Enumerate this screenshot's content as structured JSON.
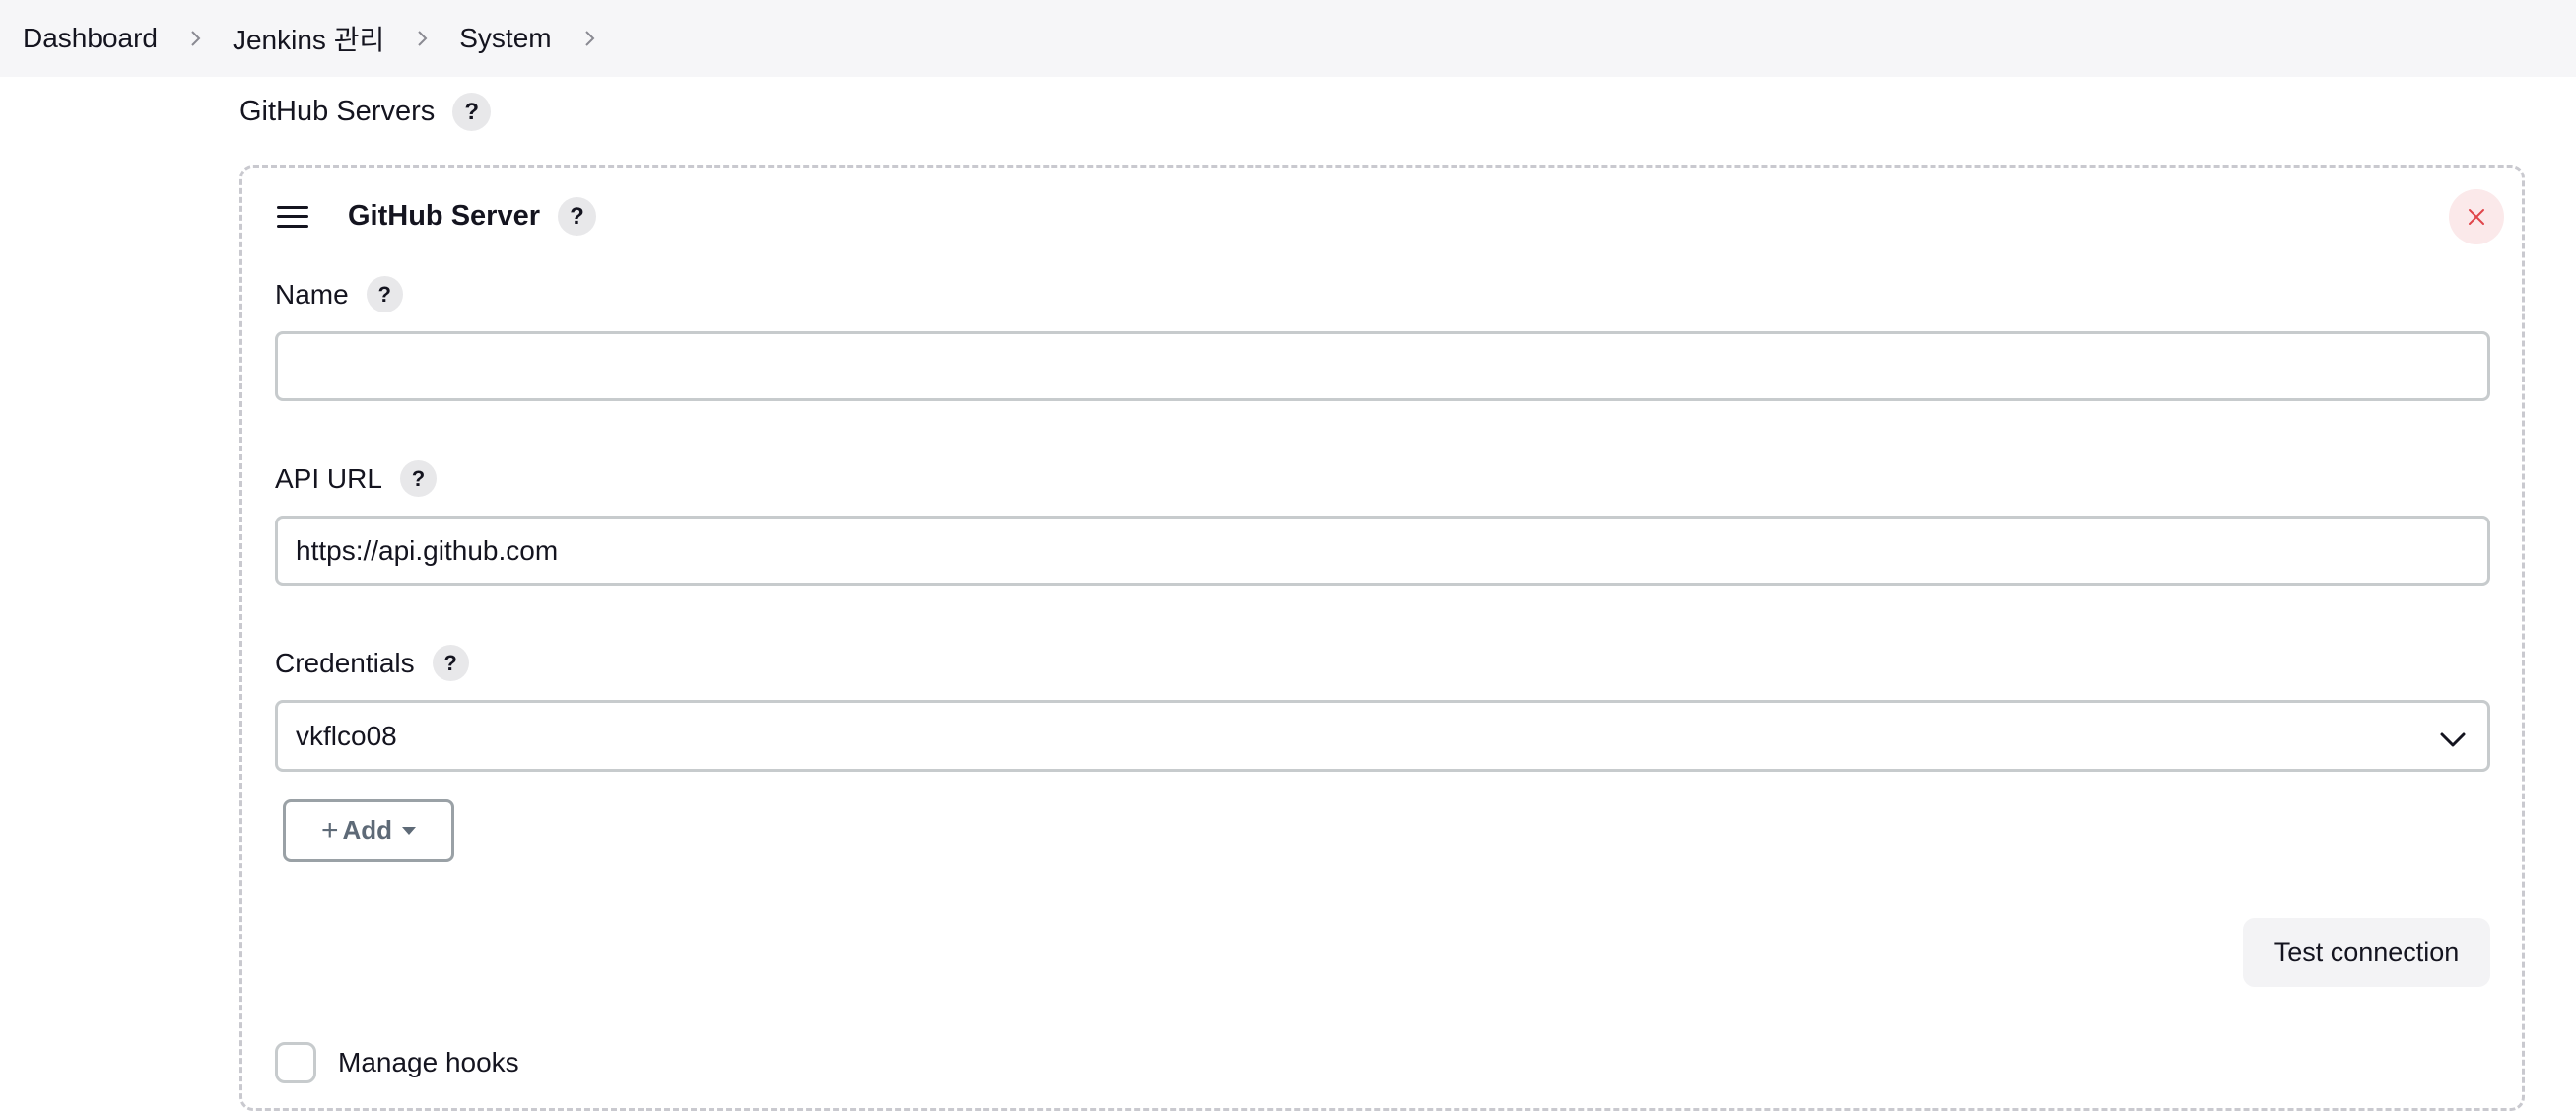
{
  "breadcrumb": {
    "items": [
      "Dashboard",
      "Jenkins 관리",
      "System"
    ]
  },
  "section": {
    "title": "GitHub Servers",
    "help": "?"
  },
  "server_card": {
    "title": "GitHub Server",
    "help": "?",
    "name_field": {
      "label": "Name",
      "help": "?",
      "value": ""
    },
    "api_url_field": {
      "label": "API URL",
      "help": "?",
      "value": "https://api.github.com"
    },
    "credentials_field": {
      "label": "Credentials",
      "help": "?",
      "selected": "vkflco08"
    },
    "add_button": {
      "plus": "+",
      "label": "Add"
    },
    "test_connection_label": "Test connection",
    "manage_hooks_label": "Manage hooks"
  },
  "icons": {
    "crumb_separator": "chevron-right-icon",
    "drag": "drag-handle-icon",
    "close": "close-icon",
    "select_chevron": "chevron-down-icon",
    "add_caret": "caret-down-icon"
  },
  "colors": {
    "close_icon": "#e0464b",
    "close_bg": "#fbe9ea",
    "breadcrumb_bg": "#f6f6f8",
    "add_button_text": "#5e6a77"
  }
}
